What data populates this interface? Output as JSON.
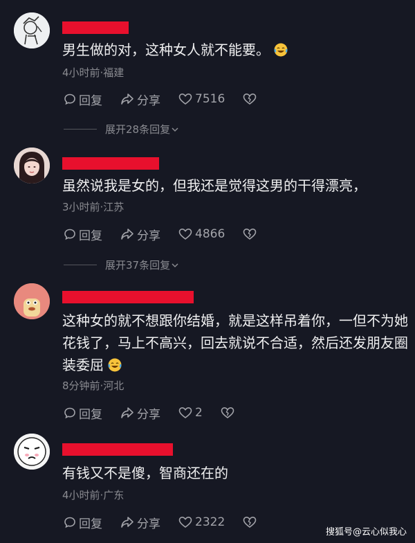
{
  "comments": [
    {
      "text": "男生做的对，这种女人就不能要。",
      "emoji": "laugh-cry-emoji",
      "meta": "4小时前·福建",
      "reply": "回复",
      "share": "分享",
      "likes": "7516",
      "expand": "展开28条回复"
    },
    {
      "text": "虽然说我是女的，但我还是觉得这男的干得漂亮，",
      "meta": "3小时前·江苏",
      "reply": "回复",
      "share": "分享",
      "likes": "4866",
      "expand": "展开37条回复"
    },
    {
      "text_line1": "这种女的就不想跟你结婚，就是这样吊着你，一但不为她",
      "text_line2": "花钱了，马上不高兴，回去就说不合适，然后还发朋友圈",
      "text_line3": "装委屈",
      "emoji": "laugh-cry-emoji",
      "meta": "8分钟前·河北",
      "reply": "回复",
      "share": "分享",
      "likes": "2"
    },
    {
      "text": "有钱又不是傻，智商还在的",
      "meta": "4小时前·广东",
      "reply": "回复",
      "share": "分享",
      "likes": "2322"
    }
  ],
  "watermark": "搜狐号@云心似我心",
  "colors": {
    "background": "#161823",
    "redaction": "#e8102d",
    "text": "#efeff0",
    "muted": "#8a8b91"
  }
}
